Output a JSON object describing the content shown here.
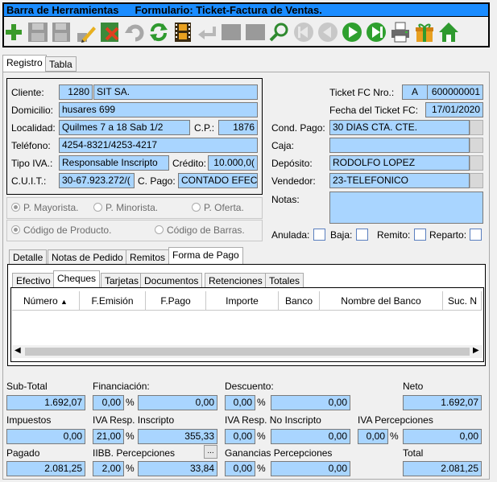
{
  "title": {
    "toolbar": "Barra de Herramientas",
    "form": "Formulario: Ticket-Factura de Ventas."
  },
  "toolbar": [
    "add-icon",
    "save-icon",
    "save-as-icon",
    "edit-icon",
    "delete-icon",
    "undo-icon",
    "refresh-icon",
    "film-icon",
    "back-arrow-icon",
    "blank-icon",
    "blank-icon",
    "search-icon",
    "first-record-icon",
    "previous-record-icon",
    "next-record-icon",
    "last-record-icon",
    "print-icon",
    "gift-icon",
    "home-icon"
  ],
  "main_tabs": [
    "Registro",
    "Tabla"
  ],
  "cliente": {
    "cliente_label": "Cliente:",
    "cliente_code": "1280",
    "cliente_name": "SIT SA.",
    "domicilio_label": "Domicilio:",
    "domicilio": "husares  699",
    "localidad_label": "Localidad:",
    "localidad": "Quilmes 7 a 18 Sab 1/2",
    "cp_label": "C.P.:",
    "cp": "1876",
    "telefono_label": "Teléfono:",
    "telefono": "4254-8321/4253-4217",
    "iva_label": "Tipo IVA.:",
    "iva": "Responsable Inscripto",
    "credito_label": "Crédito:",
    "credito": "10.000,0(",
    "cuit_label": "C.U.I.T.:",
    "cuit": "30-67.923.272/(",
    "cpago_label": "C. Pago:",
    "cpago": "CONTADO EFEC"
  },
  "price_options": [
    "P. Mayorista.",
    "P. Minorista.",
    "P. Oferta."
  ],
  "code_options": [
    "Código de Producto.",
    "Código de Barras."
  ],
  "ticket": {
    "nro_label": "Ticket FC Nro.:",
    "nro_letter": "A",
    "nro": "600000001",
    "fecha_label": "Fecha del Ticket FC:",
    "fecha": "17/01/2020",
    "cond_label": "Cond. Pago:",
    "cond": "30 DIAS CTA. CTE.",
    "caja_label": "Caja:",
    "caja": "",
    "deposito_label": "Depósito:",
    "deposito": "RODOLFO LOPEZ",
    "vendedor_label": "Vendedor:",
    "vendedor": "23-TELEFONICO",
    "notas_label": "Notas:",
    "notas": ""
  },
  "flags": {
    "anulada": "Anulada:",
    "baja": "Baja:",
    "remito": "Remito:",
    "reparto": "Reparto:"
  },
  "detail_tabs": [
    "Detalle",
    "Notas de Pedido",
    "Remitos",
    "Forma de Pago"
  ],
  "payment_tabs": [
    "Efectivo",
    "Cheques",
    "Tarjetas",
    "Documentos",
    "Retenciones",
    "Totales"
  ],
  "grid_columns": [
    "Número",
    "F.Emisión",
    "F.Pago",
    "Importe",
    "Banco",
    "Nombre del Banco",
    "Suc. N"
  ],
  "totals": {
    "subtotal_label": "Sub-Total",
    "subtotal": "1.692,07",
    "financiacion_label": "Financiación:",
    "fin_pct": "0,00",
    "fin_val": "0,00",
    "descuento_label": "Descuento:",
    "desc_pct": "0,00",
    "desc_val": "0,00",
    "neto_label": "Neto",
    "neto": "1.692,07",
    "impuestos_label": "Impuestos",
    "impuestos": "0,00",
    "iva_ri_label": "IVA Resp. Inscripto",
    "iva_ri_pct": "21,00",
    "iva_ri_val": "355,33",
    "iva_rni_label": "IVA Resp. No Inscripto",
    "iva_rni_pct": "0,00",
    "iva_rni_val": "0,00",
    "iva_perc_label": "IVA Percepciones",
    "iva_perc_pct": "0,00",
    "iva_perc_val": "0,00",
    "pagado_label": "Pagado",
    "pagado": "2.081,25",
    "iibb_label": "IIBB. Percepciones",
    "iibb_pct": "2,00",
    "iibb_val": "33,84",
    "iibb_btn": "...",
    "ganancias_label": "Ganancias Percepciones",
    "gan_pct": "0,00",
    "gan_val": "0,00",
    "total_label": "Total",
    "total": "2.081,25",
    "pct": "%"
  }
}
